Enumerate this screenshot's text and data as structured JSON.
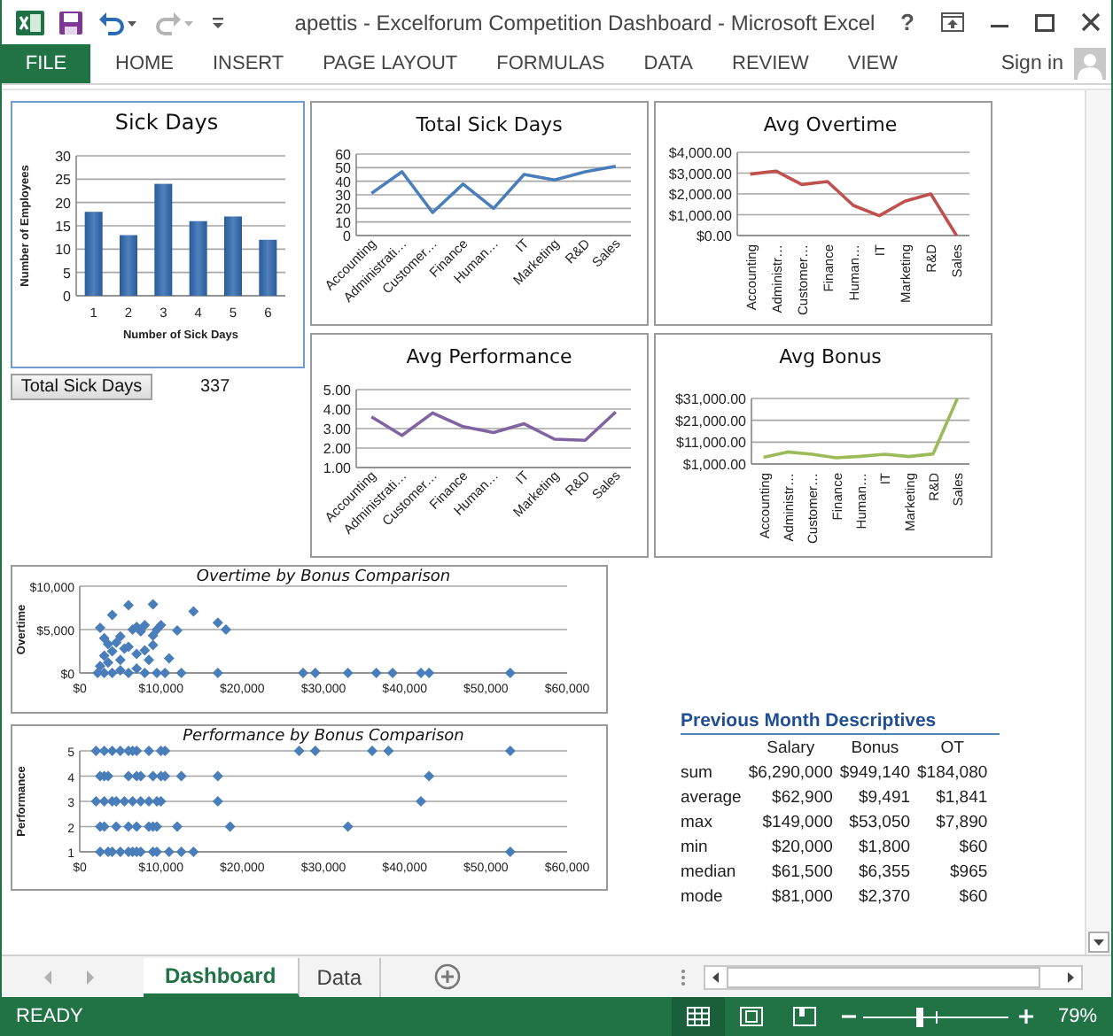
{
  "window": {
    "title": "apettis - Excelforum Competition Dashboard - Microsoft Excel",
    "help": "?"
  },
  "ribbon": {
    "tabs": [
      {
        "label": "FILE",
        "kind": "file"
      },
      {
        "label": "HOME",
        "kind": "tab"
      },
      {
        "label": "INSERT",
        "kind": "tab"
      },
      {
        "label": "PAGE LAYOUT",
        "kind": "tab"
      },
      {
        "label": "FORMULAS",
        "kind": "tab"
      },
      {
        "label": "DATA",
        "kind": "tab"
      },
      {
        "label": "REVIEW",
        "kind": "tab"
      },
      {
        "label": "VIEW",
        "kind": "tab"
      }
    ],
    "sign_in": "Sign in"
  },
  "charts": [
    {
      "selected": true,
      "chart_data": {
        "type": "bar",
        "title": "Sick Days",
        "xlabel": "Number of Sick Days",
        "ylabel": "Number of Employees",
        "categories": [
          "1",
          "2",
          "3",
          "4",
          "5",
          "6"
        ],
        "grid": true,
        "series": [
          {
            "color": "#4f81bd",
            "values": [
              18,
              13,
              24,
              16,
              17,
              12
            ]
          }
        ],
        "ylim": [
          0,
          30
        ],
        "yticks": [
          0,
          5,
          10,
          15,
          20,
          25,
          30
        ]
      }
    },
    {
      "selected": false,
      "chart_data": {
        "type": "line",
        "title": "Total Sick Days",
        "categories": [
          "Accounting",
          "Administrati…",
          "Customer…",
          "Finance",
          "Human…",
          "IT",
          "Marketing",
          "R&D",
          "Sales"
        ],
        "grid": true,
        "series": [
          {
            "color": "#4a7ebb",
            "values": [
              31,
              47,
              17,
              38,
              20,
              45,
              41,
              47,
              51
            ]
          }
        ],
        "ylim": [
          0,
          60
        ],
        "yticks": [
          0,
          10,
          20,
          30,
          40,
          50,
          60
        ]
      }
    },
    {
      "selected": false,
      "chart_data": {
        "type": "line",
        "title": "Avg Overtime",
        "categories": [
          "Accounting",
          "Administr…",
          "Customer…",
          "Finance",
          "Human…",
          "IT",
          "Marketing",
          "R&D",
          "Sales"
        ],
        "grid": true,
        "series": [
          {
            "color": "#c0504d",
            "values": [
              2950,
              3100,
              2450,
              2600,
              1450,
              950,
              1650,
              2000,
              0
            ]
          }
        ],
        "ylim": [
          0,
          4000
        ],
        "yticks": [
          {
            "value": 0,
            "label": "$0.00"
          },
          {
            "value": 1000,
            "label": "$1,000.00"
          },
          {
            "value": 2000,
            "label": "$2,000.00"
          },
          {
            "value": 3000,
            "label": "$3,000.00"
          },
          {
            "value": 4000,
            "label": "$4,000.00"
          }
        ]
      }
    },
    {
      "selected": false,
      "chart_data": {
        "type": "line",
        "title": "Avg Performance",
        "categories": [
          "Accounting",
          "Administrati…",
          "Customer…",
          "Finance",
          "Human…",
          "IT",
          "Marketing",
          "R&D",
          "Sales"
        ],
        "grid": true,
        "series": [
          {
            "color": "#8064a2",
            "values": [
              3.6,
              2.65,
              3.8,
              3.1,
              2.8,
              3.25,
              2.45,
              2.4,
              3.85
            ]
          }
        ],
        "ylim": [
          1,
          5
        ],
        "yticks": [
          {
            "value": 1,
            "label": "1.00"
          },
          {
            "value": 2,
            "label": "2.00"
          },
          {
            "value": 3,
            "label": "3.00"
          },
          {
            "value": 4,
            "label": "4.00"
          },
          {
            "value": 5,
            "label": "5.00"
          }
        ]
      }
    },
    {
      "selected": false,
      "chart_data": {
        "type": "line",
        "title": "Avg Bonus",
        "categories": [
          "Accounting",
          "Administr…",
          "Customer…",
          "Finance",
          "Human…",
          "IT",
          "Marketing",
          "R&D",
          "Sales"
        ],
        "grid": true,
        "series": [
          {
            "color": "#9bbb59",
            "values": [
              4000,
              6500,
              5500,
              3800,
              4500,
              5500,
              4400,
              5600,
              31000
            ]
          }
        ],
        "ylim": [
          1000,
          31000
        ],
        "yticks": [
          {
            "value": 1000,
            "label": "$1,000.00"
          },
          {
            "value": 11000,
            "label": "$11,000.00"
          },
          {
            "value": 21000,
            "label": "$21,000.00"
          },
          {
            "value": 31000,
            "label": "$31,000.00"
          }
        ]
      }
    },
    {
      "selected": false,
      "chart_data": {
        "type": "scatter",
        "title": "Overtime by Bonus Comparison",
        "ylabel": "Overtime",
        "x": [
          2500,
          3000,
          4000,
          4500,
          5000,
          6000,
          6500,
          7000,
          7500,
          8000,
          9000,
          9500,
          10000,
          9000,
          12000,
          14000,
          17000,
          18000,
          11000,
          3000,
          2500,
          3500,
          4000,
          5000,
          6000,
          7000,
          8000,
          9000,
          2200,
          3000,
          4000,
          5000,
          6000,
          7000,
          8000,
          9500,
          10500,
          12500,
          17000,
          27500,
          29000,
          33000,
          36500,
          38500,
          42000,
          43000,
          53000,
          8500,
          3500,
          5500
        ],
        "grid": true,
        "series": [
          {
            "color": "#4a7ebb",
            "values": [
              5200,
              4000,
              6700,
              3500,
              4200,
              7800,
              5000,
              5300,
              4800,
              5500,
              7900,
              5000,
              5500,
              4300,
              4900,
              7100,
              5800,
              5000,
              1700,
              2000,
              800,
              1200,
              2500,
              1500,
              3000,
              2200,
              2600,
              3200,
              0,
              0,
              0,
              300,
              0,
              500,
              0,
              0,
              0,
              0,
              0,
              0,
              0,
              0,
              0,
              0,
              0,
              0,
              0,
              1500,
              3300,
              2800
            ]
          }
        ],
        "xlim": [
          0,
          60000
        ],
        "ylim": [
          0,
          10000
        ],
        "xticks": [
          {
            "value": 0,
            "label": "$0"
          },
          {
            "value": 10000,
            "label": "$10,000"
          },
          {
            "value": 20000,
            "label": "$20,000"
          },
          {
            "value": 30000,
            "label": "$30,000"
          },
          {
            "value": 40000,
            "label": "$40,000"
          },
          {
            "value": 50000,
            "label": "$50,000"
          },
          {
            "value": 60000,
            "label": "$60,000"
          }
        ],
        "yticks": [
          {
            "value": 0,
            "label": "$0"
          },
          {
            "value": 5000,
            "label": "$5,000"
          },
          {
            "value": 10000,
            "label": "$10,000"
          }
        ]
      }
    },
    {
      "selected": false,
      "chart_data": {
        "type": "scatter",
        "title": "Performance by Bonus Comparison",
        "ylabel": "Performance",
        "x": [
          2000,
          3000,
          4000,
          5000,
          6000,
          6500,
          7000,
          8500,
          10000,
          10500,
          27000,
          29000,
          36000,
          38000,
          53000,
          2500,
          3000,
          3500,
          6000,
          7000,
          7500,
          9000,
          10000,
          10500,
          12500,
          17000,
          43000,
          2000,
          3000,
          4000,
          4500,
          5500,
          6500,
          7500,
          8500,
          9500,
          10000,
          17000,
          42000,
          2500,
          3000,
          4500,
          6000,
          7000,
          8500,
          9000,
          9500,
          12000,
          18500,
          33000,
          2500,
          3500,
          4000,
          5000,
          6000,
          6500,
          7000,
          7500,
          9000,
          9500,
          11000,
          12500,
          14000,
          53000
        ],
        "grid": true,
        "series": [
          {
            "color": "#4a7ebb",
            "values": [
              5,
              5,
              5,
              5,
              5,
              5,
              5,
              5,
              5,
              5,
              5,
              5,
              5,
              5,
              5,
              4,
              4,
              4,
              4,
              4,
              4,
              4,
              4,
              4,
              4,
              4,
              4,
              3,
              3,
              3,
              3,
              3,
              3,
              3,
              3,
              3,
              3,
              3,
              3,
              2,
              2,
              2,
              2,
              2,
              2,
              2,
              2,
              2,
              2,
              2,
              1,
              1,
              1,
              1,
              1,
              1,
              1,
              1,
              1,
              1,
              1,
              1,
              1,
              1
            ]
          }
        ],
        "xlim": [
          0,
          60000
        ],
        "ylim": [
          1,
          5
        ],
        "xticks": [
          {
            "value": 0,
            "label": "$0"
          },
          {
            "value": 10000,
            "label": "$10,000"
          },
          {
            "value": 20000,
            "label": "$20,000"
          },
          {
            "value": 30000,
            "label": "$30,000"
          },
          {
            "value": 40000,
            "label": "$40,000"
          },
          {
            "value": 50000,
            "label": "$50,000"
          },
          {
            "value": 60000,
            "label": "$60,000"
          }
        ],
        "yticks": [
          1,
          2,
          3,
          4,
          5
        ]
      }
    }
  ],
  "sick_days_total": {
    "button": "Total Sick Days",
    "value": "337"
  },
  "descriptives": {
    "title": "Previous Month Descriptives",
    "columns": [
      "Salary",
      "Bonus",
      "OT"
    ],
    "rows": [
      {
        "label": "sum",
        "cells": [
          "$6,290,000",
          "$949,140",
          "$184,080"
        ]
      },
      {
        "label": "average",
        "cells": [
          "$62,900",
          "$9,491",
          "$1,841"
        ]
      },
      {
        "label": "max",
        "cells": [
          "$149,000",
          "$53,050",
          "$7,890"
        ]
      },
      {
        "label": "min",
        "cells": [
          "$20,000",
          "$1,800",
          "$60"
        ]
      },
      {
        "label": "median",
        "cells": [
          "$61,500",
          "$6,355",
          "$965"
        ]
      },
      {
        "label": "mode",
        "cells": [
          "$81,000",
          "$2,370",
          "$60"
        ]
      }
    ]
  },
  "sheet_tabs": [
    {
      "label": "Dashboard",
      "selected": true
    },
    {
      "label": "Data",
      "selected": false
    }
  ],
  "status_bar": {
    "status": "READY",
    "views": [
      {
        "kind": "normal",
        "selected": true
      },
      {
        "kind": "page_layout",
        "selected": false
      },
      {
        "kind": "page_break",
        "selected": false
      }
    ],
    "zoom": {
      "level": 0.39
    },
    "zoom_text": "79%"
  }
}
